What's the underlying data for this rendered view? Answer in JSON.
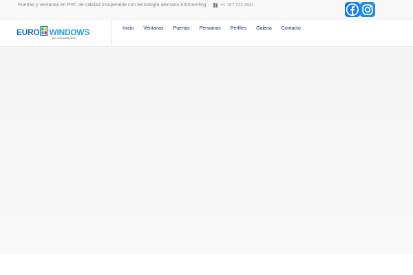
{
  "topbar": {
    "tagline": "Puertas y ventanas en PVC de calidad insuperable con tecnología alemana Kömmerling",
    "phone": "+1 787 722 2531",
    "phone_icon": "phone-icon",
    "social": [
      {
        "name": "Facebook",
        "icon": "facebook-icon",
        "color": "#1877f2"
      },
      {
        "name": "Instagram",
        "icon": "instagram-icon",
        "color": "#1d8ee6"
      }
    ]
  },
  "header": {
    "logo": {
      "text_left": "EURO",
      "text_right": "WINDOWS",
      "by_line": "BY KÖMMERLING",
      "colors": {
        "euro": "#1d6fb8",
        "windows": "#2a9de0"
      }
    },
    "nav": [
      {
        "label": "Inicio"
      },
      {
        "label": "Ventanas"
      },
      {
        "label": "Puertas"
      },
      {
        "label": "Persianas"
      },
      {
        "label": "Perfiles"
      },
      {
        "label": "Galeria"
      },
      {
        "label": "Contacto"
      }
    ],
    "nav_color": "#0a2a6a"
  },
  "hero": {
    "background": "#f7f7f7"
  }
}
